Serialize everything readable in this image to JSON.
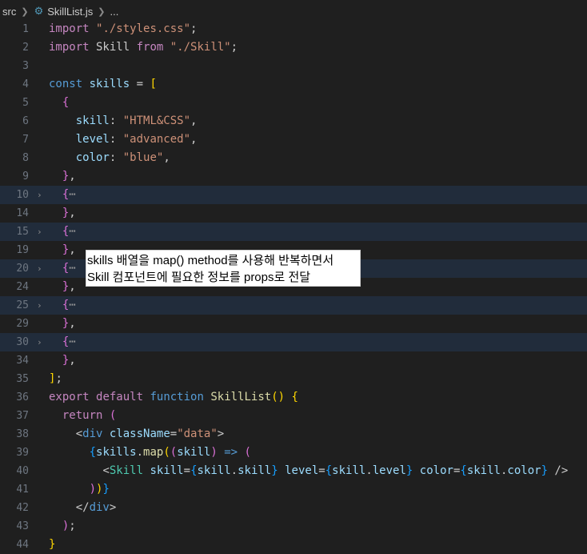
{
  "breadcrumb": {
    "folder": "src",
    "file": "SkillList.js",
    "more": "..."
  },
  "lines": [
    {
      "n": "1",
      "tokens": [
        [
          "import",
          "t-ctrl"
        ],
        [
          " ",
          "t-p"
        ],
        [
          "\"./styles.css\"",
          "t-str"
        ],
        [
          ";",
          "t-p"
        ]
      ]
    },
    {
      "n": "2",
      "tokens": [
        [
          "import",
          "t-ctrl"
        ],
        [
          " Skill ",
          "t-p"
        ],
        [
          "from",
          "t-ctrl"
        ],
        [
          " ",
          "t-p"
        ],
        [
          "\"./Skill\"",
          "t-str"
        ],
        [
          ";",
          "t-p"
        ]
      ]
    },
    {
      "n": "3",
      "tokens": []
    },
    {
      "n": "4",
      "tokens": [
        [
          "const",
          "t-kw"
        ],
        [
          " ",
          "t-p"
        ],
        [
          "skills",
          "t-var"
        ],
        [
          " = ",
          "t-p"
        ],
        [
          "[",
          "t-b1"
        ]
      ]
    },
    {
      "n": "5",
      "tokens": [
        [
          "  ",
          "t-p"
        ],
        [
          "{",
          "t-b2"
        ]
      ]
    },
    {
      "n": "6",
      "tokens": [
        [
          "    ",
          "t-p"
        ],
        [
          "skill",
          "t-var"
        ],
        [
          ": ",
          "t-p"
        ],
        [
          "\"HTML&CSS\"",
          "t-str"
        ],
        [
          ",",
          "t-p"
        ]
      ]
    },
    {
      "n": "7",
      "tokens": [
        [
          "    ",
          "t-p"
        ],
        [
          "level",
          "t-var"
        ],
        [
          ": ",
          "t-p"
        ],
        [
          "\"advanced\"",
          "t-str"
        ],
        [
          ",",
          "t-p"
        ]
      ]
    },
    {
      "n": "8",
      "tokens": [
        [
          "    ",
          "t-p"
        ],
        [
          "color",
          "t-var"
        ],
        [
          ": ",
          "t-p"
        ],
        [
          "\"blue\"",
          "t-str"
        ],
        [
          ",",
          "t-p"
        ]
      ]
    },
    {
      "n": "9",
      "tokens": [
        [
          "  ",
          "t-p"
        ],
        [
          "}",
          "t-b2"
        ],
        [
          ",",
          "t-p"
        ]
      ]
    },
    {
      "n": "10",
      "fold": true,
      "tokens": [
        [
          "  ",
          "t-p"
        ],
        [
          "{",
          "t-b2"
        ],
        [
          "⋯",
          "t-fold"
        ]
      ]
    },
    {
      "n": "14",
      "tokens": [
        [
          "  ",
          "t-p"
        ],
        [
          "}",
          "t-b2"
        ],
        [
          ",",
          "t-p"
        ]
      ]
    },
    {
      "n": "15",
      "fold": true,
      "tokens": [
        [
          "  ",
          "t-p"
        ],
        [
          "{",
          "t-b2"
        ],
        [
          "⋯",
          "t-fold"
        ]
      ]
    },
    {
      "n": "19",
      "tokens": [
        [
          "  ",
          "t-p"
        ],
        [
          "}",
          "t-b2"
        ],
        [
          ",",
          "t-p"
        ]
      ]
    },
    {
      "n": "20",
      "fold": true,
      "tokens": [
        [
          "  ",
          "t-p"
        ],
        [
          "{",
          "t-b2"
        ],
        [
          "⋯",
          "t-fold"
        ]
      ]
    },
    {
      "n": "24",
      "tokens": [
        [
          "  ",
          "t-p"
        ],
        [
          "}",
          "t-b2"
        ],
        [
          ",",
          "t-p"
        ]
      ]
    },
    {
      "n": "25",
      "fold": true,
      "tokens": [
        [
          "  ",
          "t-p"
        ],
        [
          "{",
          "t-b2"
        ],
        [
          "⋯",
          "t-fold"
        ]
      ]
    },
    {
      "n": "29",
      "tokens": [
        [
          "  ",
          "t-p"
        ],
        [
          "}",
          "t-b2"
        ],
        [
          ",",
          "t-p"
        ]
      ]
    },
    {
      "n": "30",
      "fold": true,
      "tokens": [
        [
          "  ",
          "t-p"
        ],
        [
          "{",
          "t-b2"
        ],
        [
          "⋯",
          "t-fold"
        ]
      ]
    },
    {
      "n": "34",
      "tokens": [
        [
          "  ",
          "t-p"
        ],
        [
          "}",
          "t-b2"
        ],
        [
          ",",
          "t-p"
        ]
      ]
    },
    {
      "n": "35",
      "tokens": [
        [
          "]",
          "t-b1"
        ],
        [
          ";",
          "t-p"
        ]
      ]
    },
    {
      "n": "36",
      "tokens": [
        [
          "export",
          "t-ctrl"
        ],
        [
          " ",
          "t-p"
        ],
        [
          "default",
          "t-ctrl"
        ],
        [
          " ",
          "t-p"
        ],
        [
          "function",
          "t-kw"
        ],
        [
          " ",
          "t-p"
        ],
        [
          "SkillList",
          "t-fn"
        ],
        [
          "()",
          "t-b1"
        ],
        [
          " ",
          "t-p"
        ],
        [
          "{",
          "t-b1"
        ]
      ]
    },
    {
      "n": "37",
      "tokens": [
        [
          "  ",
          "t-p"
        ],
        [
          "return",
          "t-ctrl"
        ],
        [
          " ",
          "t-p"
        ],
        [
          "(",
          "t-b2"
        ]
      ]
    },
    {
      "n": "38",
      "tokens": [
        [
          "    ",
          "t-p"
        ],
        [
          "<",
          "t-p"
        ],
        [
          "div",
          "t-tag"
        ],
        [
          " ",
          "t-p"
        ],
        [
          "className",
          "t-attr"
        ],
        [
          "=",
          "t-p"
        ],
        [
          "\"data\"",
          "t-str"
        ],
        [
          ">",
          "t-p"
        ]
      ]
    },
    {
      "n": "39",
      "tokens": [
        [
          "      ",
          "t-p"
        ],
        [
          "{",
          "t-b3"
        ],
        [
          "skills",
          "t-var"
        ],
        [
          ".",
          "t-p"
        ],
        [
          "map",
          "t-fn"
        ],
        [
          "(",
          "t-b1"
        ],
        [
          "(",
          "t-b2"
        ],
        [
          "skill",
          "t-var"
        ],
        [
          ")",
          "t-b2"
        ],
        [
          " => ",
          "t-kw"
        ],
        [
          "(",
          "t-b2"
        ]
      ]
    },
    {
      "n": "40",
      "tokens": [
        [
          "        ",
          "t-p"
        ],
        [
          "<",
          "t-p"
        ],
        [
          "Skill",
          "t-comp"
        ],
        [
          " ",
          "t-p"
        ],
        [
          "skill",
          "t-attr"
        ],
        [
          "=",
          "t-p"
        ],
        [
          "{",
          "t-b3"
        ],
        [
          "skill",
          "t-var"
        ],
        [
          ".",
          "t-p"
        ],
        [
          "skill",
          "t-var"
        ],
        [
          "}",
          "t-b3"
        ],
        [
          " ",
          "t-p"
        ],
        [
          "level",
          "t-attr"
        ],
        [
          "=",
          "t-p"
        ],
        [
          "{",
          "t-b3"
        ],
        [
          "skill",
          "t-var"
        ],
        [
          ".",
          "t-p"
        ],
        [
          "level",
          "t-var"
        ],
        [
          "}",
          "t-b3"
        ],
        [
          " ",
          "t-p"
        ],
        [
          "color",
          "t-attr"
        ],
        [
          "=",
          "t-p"
        ],
        [
          "{",
          "t-b3"
        ],
        [
          "skill",
          "t-var"
        ],
        [
          ".",
          "t-p"
        ],
        [
          "color",
          "t-var"
        ],
        [
          "}",
          "t-b3"
        ],
        [
          " />",
          "t-p"
        ]
      ]
    },
    {
      "n": "41",
      "tokens": [
        [
          "      ",
          "t-p"
        ],
        [
          ")",
          "t-b2"
        ],
        [
          ")",
          "t-b1"
        ],
        [
          "}",
          "t-b3"
        ]
      ]
    },
    {
      "n": "42",
      "tokens": [
        [
          "    ",
          "t-p"
        ],
        [
          "</",
          "t-p"
        ],
        [
          "div",
          "t-tag"
        ],
        [
          ">",
          "t-p"
        ]
      ]
    },
    {
      "n": "43",
      "tokens": [
        [
          "  ",
          "t-p"
        ],
        [
          ")",
          "t-b2"
        ],
        [
          ";",
          "t-p"
        ]
      ]
    },
    {
      "n": "44",
      "tokens": [
        [
          "}",
          "t-b1"
        ]
      ]
    }
  ],
  "tooltip": {
    "line1": "skills 배열을 map() method를 사용해 반복하면서",
    "line2": "Skill 컴포넌트에 필요한 정보를 props로 전달"
  }
}
